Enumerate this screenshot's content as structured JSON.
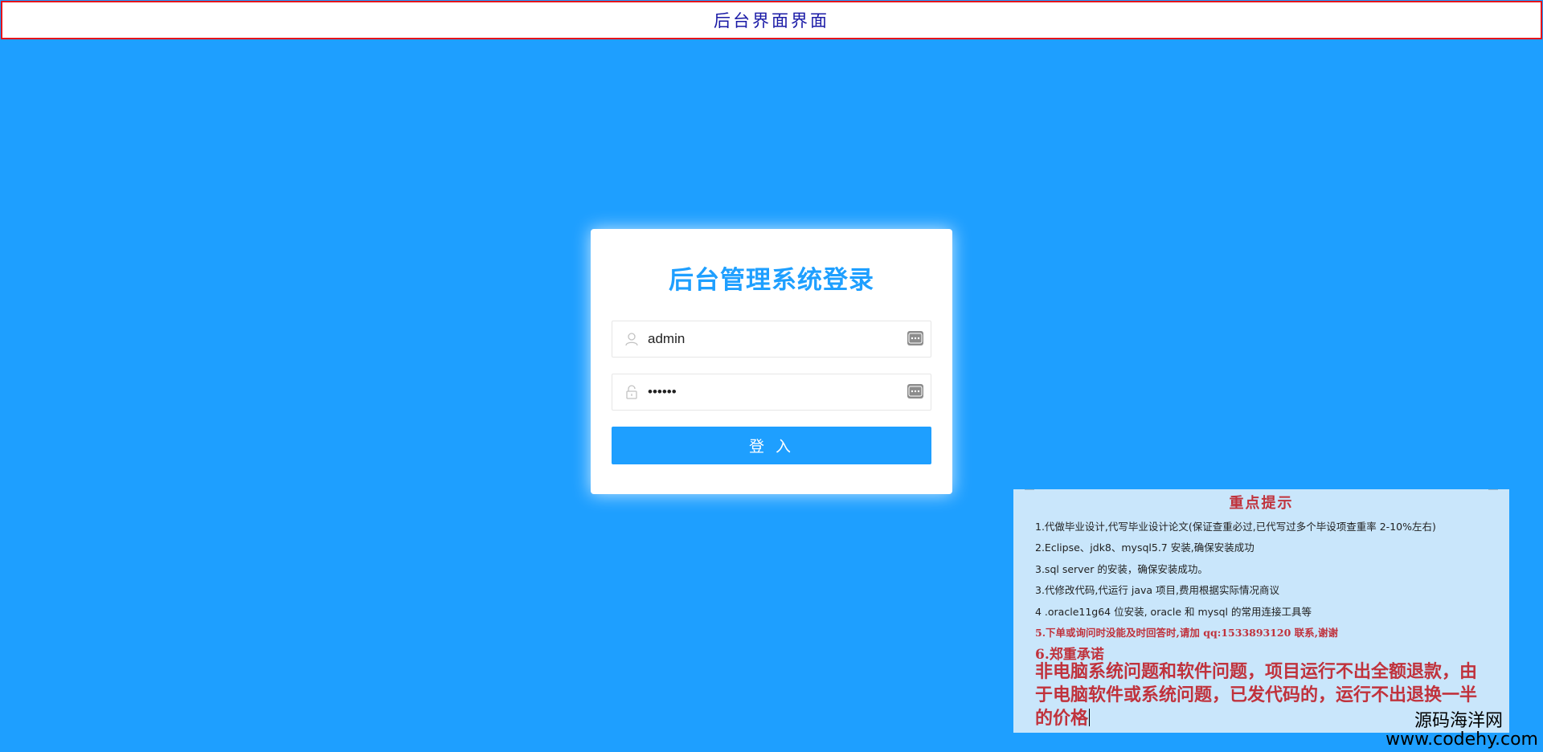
{
  "banner": {
    "title": "后台界面界面"
  },
  "login": {
    "title": "后台管理系统登录",
    "username": {
      "value": "admin",
      "icon": "user-icon"
    },
    "password": {
      "value": "123456",
      "icon": "lock-icon"
    },
    "autofill_icon": "keyboard-icon",
    "submit_label": "登 入"
  },
  "notice": {
    "title": "重点提示",
    "lines": [
      "1.代做毕业设计,代写毕业设计论文(保证查重必过,已代写过多个毕设项查重率 2-10%左右)",
      "2.Eclipse、jdk8、mysql5.7 安装,确保安装成功",
      "3.sql server 的安装，确保安装成功。",
      "3.代修改代码,代运行 java 项目,费用根据实际情况商议",
      "4 .oracle11g64 位安装, oracle 和 mysql 的常用连接工具等",
      "5.下单或询问时没能及时回答时,请加 qq:1533893120 联系,谢谢"
    ],
    "subtitle": "6.郑重承诺",
    "promise": "非电脑系统问题和软件问题，项目运行不出全额退款，由于电脑软件或系统问题，已发代码的，运行不出退换一半的价格"
  },
  "watermark": {
    "name": "源码海洋网",
    "url": "www.codehy.com"
  },
  "colors": {
    "background": "#1e9fff",
    "accent": "#1e9fff",
    "banner_border": "#e4141b",
    "banner_text": "#1a1aa6",
    "notice_bg": "#c9e6fb",
    "notice_red": "#c0323c"
  }
}
